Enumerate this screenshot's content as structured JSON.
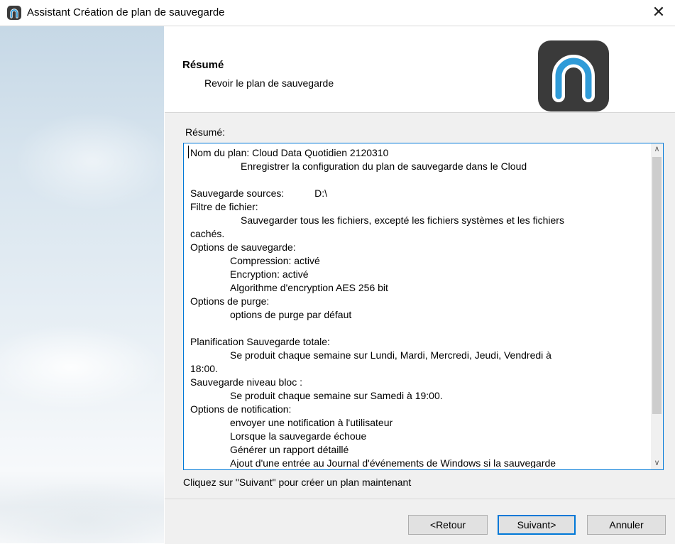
{
  "window": {
    "title": "Assistant Création de plan de sauvegarde",
    "close_glyph": "✕"
  },
  "header": {
    "title": "Résumé",
    "subtitle": "Revoir le plan de sauvegarde",
    "logo_icon": "cloud-backup-logo-icon"
  },
  "content": {
    "summary_label": "Résumé:",
    "lines": [
      {
        "text": "Nom du plan: Cloud Data Quotidien 2120310",
        "indent": 0
      },
      {
        "text": "Enregistrer la configuration du plan de sauvegarde dans le Cloud",
        "indent": 1
      },
      {
        "text": "",
        "indent": 0
      },
      {
        "text": "Sauvegarde sources:           D:\\",
        "indent": 0
      },
      {
        "text": "Filtre de fichier:",
        "indent": 0
      },
      {
        "text": "Sauvegarder tous les fichiers, excepté les fichiers systèmes et les fichiers",
        "indent": 1
      },
      {
        "text": "cachés.",
        "indent": 0
      },
      {
        "text": "Options de sauvegarde:",
        "indent": 0
      },
      {
        "text": "Compression: activé",
        "indent": 2
      },
      {
        "text": "Encryption: activé",
        "indent": 2
      },
      {
        "text": "Algorithme d'encryption AES 256 bit",
        "indent": 2
      },
      {
        "text": "Options de purge:",
        "indent": 0
      },
      {
        "text": "options de purge par défaut",
        "indent": 2
      },
      {
        "text": "",
        "indent": 0
      },
      {
        "text": "Planification Sauvegarde totale:",
        "indent": 0
      },
      {
        "text": "Se produit chaque semaine sur Lundi, Mardi, Mercredi, Jeudi, Vendredi à",
        "indent": 2
      },
      {
        "text": "18:00.",
        "indent": 0
      },
      {
        "text": "Sauvegarde niveau bloc :",
        "indent": 0
      },
      {
        "text": "Se produit chaque semaine sur Samedi à 19:00.",
        "indent": 2
      },
      {
        "text": "Options de notification:",
        "indent": 0
      },
      {
        "text": "envoyer une notification à l'utilisateur",
        "indent": 2
      },
      {
        "text": "Lorsque la sauvegarde échoue",
        "indent": 2
      },
      {
        "text": "Générer un rapport détaillé",
        "indent": 2
      },
      {
        "text": "Ajout d'une entrée au Journal d'événements de Windows si la sauvegarde",
        "indent": 2
      }
    ],
    "hint": "Cliquez sur \"Suivant\" pour créer un plan maintenant"
  },
  "footer": {
    "back_label": "<Retour",
    "next_label": "Suivant>",
    "cancel_label": "Annuler"
  },
  "colors": {
    "accent": "#0078d7",
    "logo_bg": "#3a3a3a",
    "logo_arc": "#2f9bd8"
  }
}
